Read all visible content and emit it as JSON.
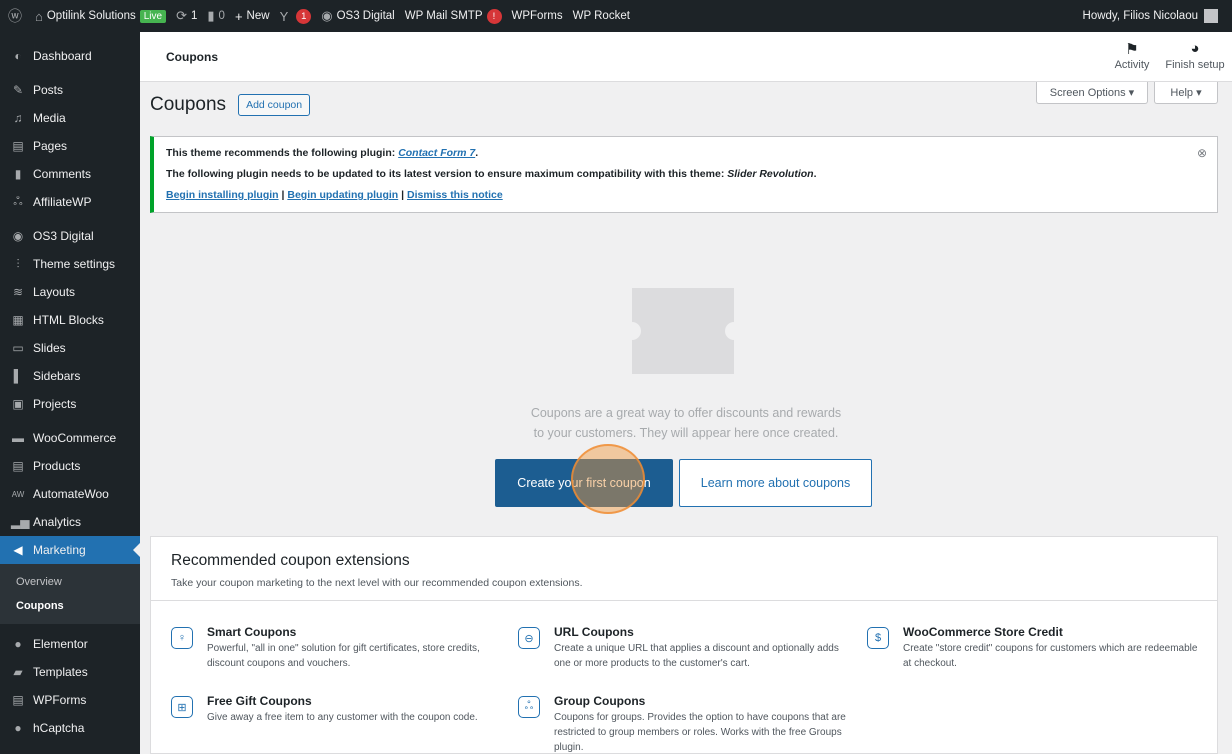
{
  "admin_bar": {
    "site_name": "Optilink Solutions",
    "live_badge": "Live",
    "updates_count": "1",
    "comments_count": "0",
    "new_label": "New",
    "yoast_count": "1",
    "os3": "OS3 Digital",
    "wp_mail_smtp": "WP Mail SMTP",
    "wpforms": "WPForms",
    "wp_rocket": "WP Rocket",
    "howdy": "Howdy, Filios Nicolaou"
  },
  "sidebar": {
    "items": [
      {
        "label": "Dashboard",
        "icon": "dashboard-icon"
      },
      {
        "label": "Posts",
        "icon": "pin-icon"
      },
      {
        "label": "Media",
        "icon": "media-icon"
      },
      {
        "label": "Pages",
        "icon": "pages-icon"
      },
      {
        "label": "Comments",
        "icon": "comment-icon"
      },
      {
        "label": "AffiliateWP",
        "icon": "affiliate-icon"
      },
      {
        "label": "OS3 Digital",
        "icon": "os3-icon"
      },
      {
        "label": "Theme settings",
        "icon": "sliders-icon"
      },
      {
        "label": "Layouts",
        "icon": "layers-icon"
      },
      {
        "label": "HTML Blocks",
        "icon": "html-blocks-icon"
      },
      {
        "label": "Slides",
        "icon": "slides-icon"
      },
      {
        "label": "Sidebars",
        "icon": "sidebars-icon"
      },
      {
        "label": "Projects",
        "icon": "briefcase-icon"
      },
      {
        "label": "WooCommerce",
        "icon": "woo-icon"
      },
      {
        "label": "Products",
        "icon": "products-icon"
      },
      {
        "label": "AutomateWoo",
        "icon": "automatewoo-icon"
      },
      {
        "label": "Analytics",
        "icon": "analytics-icon"
      },
      {
        "label": "Marketing",
        "icon": "megaphone-icon"
      },
      {
        "label": "Elementor",
        "icon": "elementor-icon"
      },
      {
        "label": "Templates",
        "icon": "folder-icon"
      },
      {
        "label": "WPForms",
        "icon": "wpforms-icon"
      },
      {
        "label": "hCaptcha",
        "icon": "hcaptcha-icon"
      }
    ],
    "submenu": [
      "Overview",
      "Coupons"
    ]
  },
  "header": {
    "title": "Coupons",
    "activity": "Activity",
    "finish_setup": "Finish setup"
  },
  "screen_options": "Screen Options ▾",
  "help": "Help ▾",
  "page": {
    "heading": "Coupons",
    "add_coupon": "Add coupon"
  },
  "notice": {
    "line1_prefix": "This theme recommends the following plugin: ",
    "line1_link": "Contact Form 7",
    "line1_suffix": ".",
    "line2_prefix": "The following plugin needs to be updated to its latest version to ensure maximum compatibility with this theme: ",
    "line2_em": "Slider Revolution",
    "line2_suffix": ".",
    "link_install": "Begin installing plugin",
    "link_update": "Begin updating plugin",
    "link_dismiss": "Dismiss this notice",
    "divider": "|"
  },
  "empty_state": {
    "line1": "Coupons are a great way to offer discounts and rewards",
    "line2": "to your customers. They will appear here once created.",
    "primary_button": "Create your first coupon",
    "secondary_button": "Learn more about coupons"
  },
  "recommended": {
    "title": "Recommended coupon extensions",
    "subtitle": "Take your coupon marketing to the next level with our recommended coupon extensions.",
    "extensions": [
      {
        "title": "Smart Coupons",
        "desc": "Powerful, \"all in one\" solution for gift certificates, store credits, discount coupons and vouchers.",
        "icon": "lightbulb-icon"
      },
      {
        "title": "URL Coupons",
        "desc": "Create a unique URL that applies a discount and optionally adds one or more products to the customer's cart.",
        "icon": "link-icon"
      },
      {
        "title": "WooCommerce Store Credit",
        "desc": "Create \"store credit\" coupons for customers which are redeemable at checkout.",
        "icon": "dollar-icon"
      },
      {
        "title": "Free Gift Coupons",
        "desc": "Give away a free item to any customer with the coupon code.",
        "icon": "gift-icon"
      },
      {
        "title": "Group Coupons",
        "desc": "Coupons for groups. Provides the option to have coupons that are restricted to group members or roles. Works with the free Groups plugin.",
        "icon": "group-icon"
      }
    ]
  },
  "colors": {
    "admin_dark": "#1d2327",
    "accent_blue": "#2271b1",
    "primary_button": "#1c5d91",
    "notice_green": "#00a32a"
  }
}
